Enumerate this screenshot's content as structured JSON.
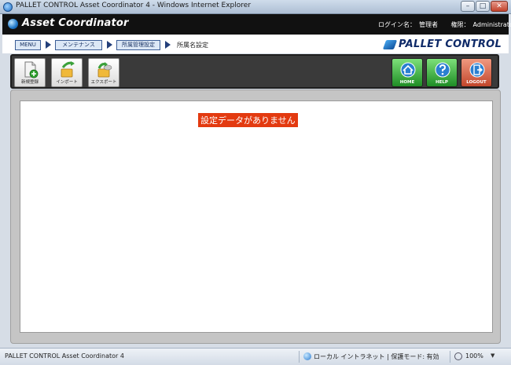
{
  "window": {
    "title": "PALLET CONTROL Asset Coordinator 4 - Windows Internet Explorer",
    "minimize": "–",
    "maximize": "□",
    "close": "✕"
  },
  "header": {
    "app_name": "Asset Coordinator",
    "login_label": "ログイン名：",
    "login_value": "管理者",
    "role_label": "権限：",
    "role_value": "Administrator"
  },
  "breadcrumb": {
    "items": [
      "MENU",
      "メンテナンス",
      "所属管理設定"
    ],
    "current": "所属名設定"
  },
  "brand": {
    "text": "PALLET CONTROL"
  },
  "toolbar": {
    "new": "新規登録",
    "import": "インポート",
    "export": "エクスポート",
    "home": "HOME",
    "help": "HELP",
    "logout": "LOGOUT"
  },
  "main": {
    "notice": "設定データがありません"
  },
  "statusbar": {
    "text": "PALLET CONTROL Asset Coordinator 4",
    "zone": "ローカル イントラネット | 保護モード: 有効",
    "zoom": "100%"
  },
  "icons": {
    "ie": "ie-icon",
    "new": "new-document-icon",
    "import": "import-arrow-icon",
    "export": "export-arrow-icon",
    "home": "home-icon",
    "help": "help-question-icon",
    "logout": "logout-door-icon"
  },
  "colors": {
    "notice_bg": "#e33a10",
    "header_bg": "#111111",
    "toolbar_bg": "#3a3a3a"
  }
}
